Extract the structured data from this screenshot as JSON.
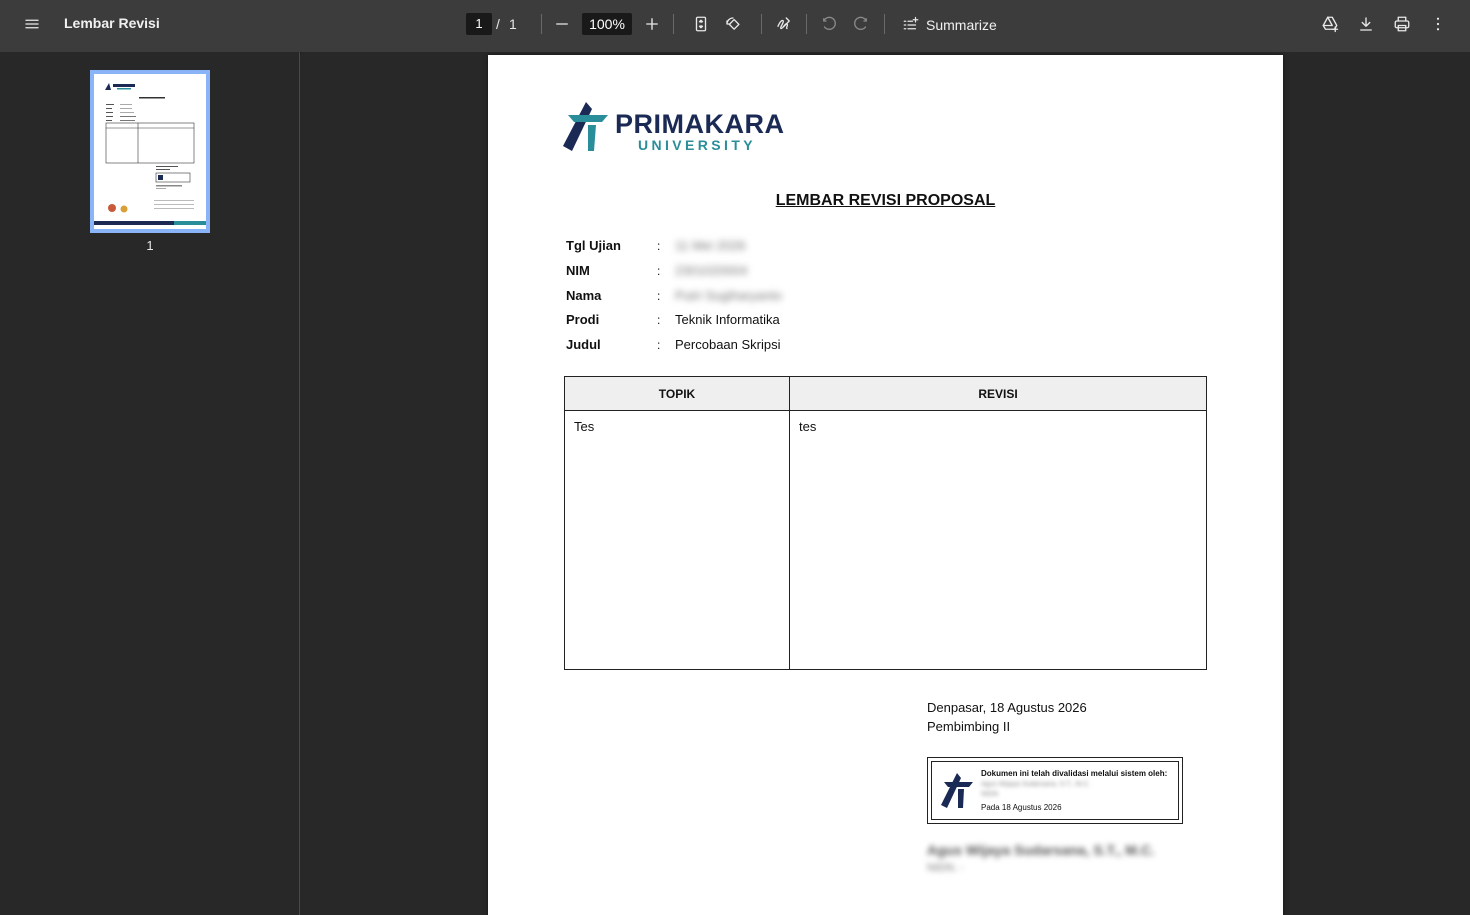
{
  "toolbar": {
    "title": "Lembar Revisi",
    "page_current": "1",
    "page_separator": "/",
    "page_total": "1",
    "zoom": "100%",
    "summarize_label": "Summarize"
  },
  "sidebar": {
    "thumbnail_page_label": "1"
  },
  "document": {
    "logo_main": "PRIMAKARA",
    "logo_sub": "UNIVERSITY",
    "heading": "LEMBAR REVISI PROPOSAL",
    "fields": [
      {
        "label": "Tgl Ujian",
        "colon": ":",
        "value": "11 Mei 2026",
        "blurred": true
      },
      {
        "label": "NIM",
        "colon": ":",
        "value": "2301020004",
        "blurred": true
      },
      {
        "label": "Nama",
        "colon": ":",
        "value": "Putri Sugiharyanto",
        "blurred": true
      },
      {
        "label": "Prodi",
        "colon": ":",
        "value": "Teknik Informatika",
        "blurred": false
      },
      {
        "label": "Judul",
        "colon": ":",
        "value": "Percobaan Skripsi",
        "blurred": false
      }
    ],
    "table": {
      "headers": [
        "TOPIK",
        "REVISI"
      ],
      "rows": [
        [
          "Tes",
          "tes"
        ]
      ]
    },
    "place_date": "Denpasar, 18 Agustus 2026",
    "signer_role": "Pembimbing II",
    "stamp": {
      "title": "Dokumen ini telah divalidasi melalui sistem oleh:",
      "blur_line1": "Agus Wijaya Sudarsana, S.T., M.C.",
      "blur_line2": "NIDN",
      "date": "Pada 18 Agustus 2026"
    },
    "signer_name": "Agus Wijaya Sudarsana, S.T., M.C.",
    "signer_id": "NIDN. -"
  }
}
